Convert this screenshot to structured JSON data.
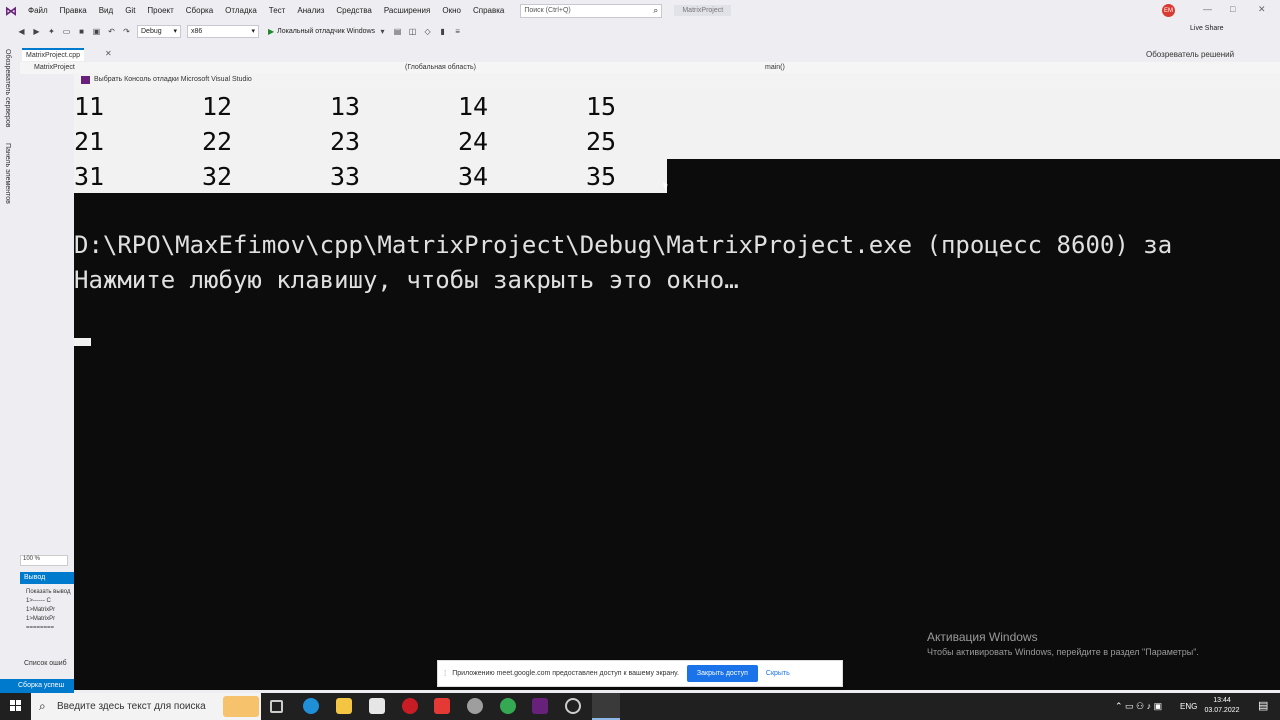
{
  "menubar": {
    "items": [
      "Файл",
      "Правка",
      "Вид",
      "Git",
      "Проект",
      "Сборка",
      "Отладка",
      "Тест",
      "Анализ",
      "Средства",
      "Расширения",
      "Окно",
      "Справка"
    ],
    "search_placeholder": "Поиск (Ctrl+Q)",
    "project_name": "MatrixProject",
    "avatar_initials": "EM"
  },
  "toolbar": {
    "config": "Debug",
    "platform": "x86",
    "run_label": "Локальный отладчик Windows",
    "live_share": "Live Share"
  },
  "left_strip": {
    "labels": [
      "Обозреватель серверов",
      "Панель элементов"
    ]
  },
  "editor": {
    "tab_label": "MatrixProject.cpp",
    "nav_project": "MatrixProject",
    "nav_scope": "(Глобальная область)",
    "nav_func": "main()",
    "solution_explorer": "Обозреватель решений",
    "zoom": "100 %",
    "output_tab": "Вывод",
    "output_show": "Показать вывод",
    "output_lines": [
      "1>------ С",
      "1>MatrixPr",
      "1>MatrixPr",
      "========"
    ],
    "errors_label": "Список ошиб",
    "status": "Сборка успеш"
  },
  "console": {
    "title": "Выбрать Консоль отладки Microsoft Visual Studio",
    "matrix": [
      [
        "11",
        "12",
        "13",
        "14",
        "15"
      ],
      [
        "21",
        "22",
        "23",
        "24",
        "25"
      ],
      [
        "31",
        "32",
        "33",
        "34",
        "35"
      ]
    ],
    "exit_line": "D:\\RPO\\MaxEfimov\\cpp\\MatrixProject\\Debug\\MatrixProject.exe (процесс 8600) за",
    "press_key_line": "Нажмите любую клавишу, чтобы закрыть это окно…"
  },
  "activation": {
    "title": "Активация Windows",
    "subtitle": "Чтобы активировать Windows, перейдите в раздел \"Параметры\"."
  },
  "share_bar": {
    "message": "Приложению meet.google.com предоставлен доступ к вашему экрану.",
    "stop_label": "Закрыть доступ",
    "hide_label": "Скрыть"
  },
  "taskbar": {
    "search_placeholder": "Введите здесь текст для поиска",
    "language": "ENG",
    "time": "13:44",
    "date": "03.07.2022"
  }
}
